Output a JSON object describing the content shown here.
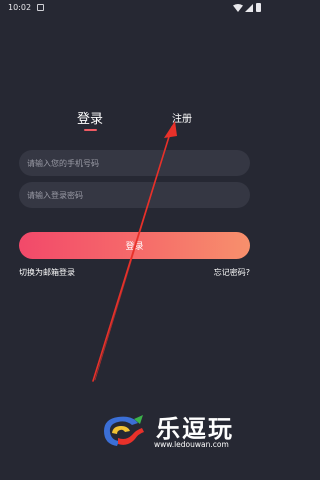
{
  "status_bar": {
    "time": "10:02"
  },
  "tabs": {
    "login": "登录",
    "register": "注册"
  },
  "form": {
    "phone_placeholder": "请输入您的手机号码",
    "password_placeholder": "请输入登录密码",
    "login_button": "登录"
  },
  "links": {
    "switch_email": "切换为邮箱登录",
    "forgot_password": "忘记密码?"
  },
  "watermark": {
    "name": "乐逗玩",
    "url": "www.ledouwan.com"
  },
  "colors": {
    "background": "#262833",
    "field": "#353743",
    "accent": "#ef5b63",
    "annotation_arrow": "#e8312a"
  }
}
